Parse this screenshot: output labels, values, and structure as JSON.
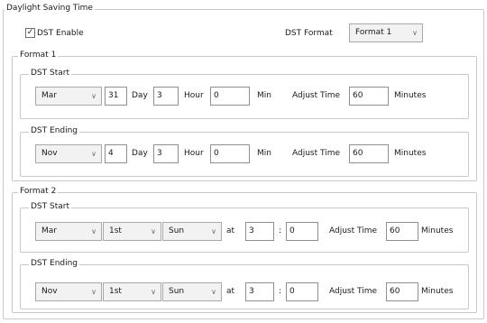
{
  "title": "Daylight Saving Time",
  "dst_enable": {
    "label": "DST Enable",
    "checked": true,
    "check_glyph": "✓"
  },
  "dst_format": {
    "label": "DST Format",
    "value": "Format 1"
  },
  "chevron": "∨",
  "format1": {
    "title": "Format 1",
    "start": {
      "title": "DST Start",
      "month": "Mar",
      "day": "31",
      "day_label": "Day",
      "hour": "3",
      "hour_label": "Hour",
      "min": "0",
      "min_label": "Min",
      "adjust_label": "Adjust Time",
      "adjust": "60",
      "minutes_label": "Minutes"
    },
    "ending": {
      "title": "DST Ending",
      "month": "Nov",
      "day": "4",
      "day_label": "Day",
      "hour": "3",
      "hour_label": "Hour",
      "min": "0",
      "min_label": "Min",
      "adjust_label": "Adjust Time",
      "adjust": "60",
      "minutes_label": "Minutes"
    }
  },
  "format2": {
    "title": "Format 2",
    "start": {
      "title": "DST Start",
      "month": "Mar",
      "week": "1st",
      "weekday": "Sun",
      "at_label": "at",
      "hour": "3",
      "colon": ":",
      "min": "0",
      "adjust_label": "Adjust Time",
      "adjust": "60",
      "minutes_label": "Minutes"
    },
    "ending": {
      "title": "DST Ending",
      "month": "Nov",
      "week": "1st",
      "weekday": "Sun",
      "at_label": "at",
      "hour": "3",
      "colon": ":",
      "min": "0",
      "adjust_label": "Adjust Time",
      "adjust": "60",
      "minutes_label": "Minutes"
    }
  }
}
